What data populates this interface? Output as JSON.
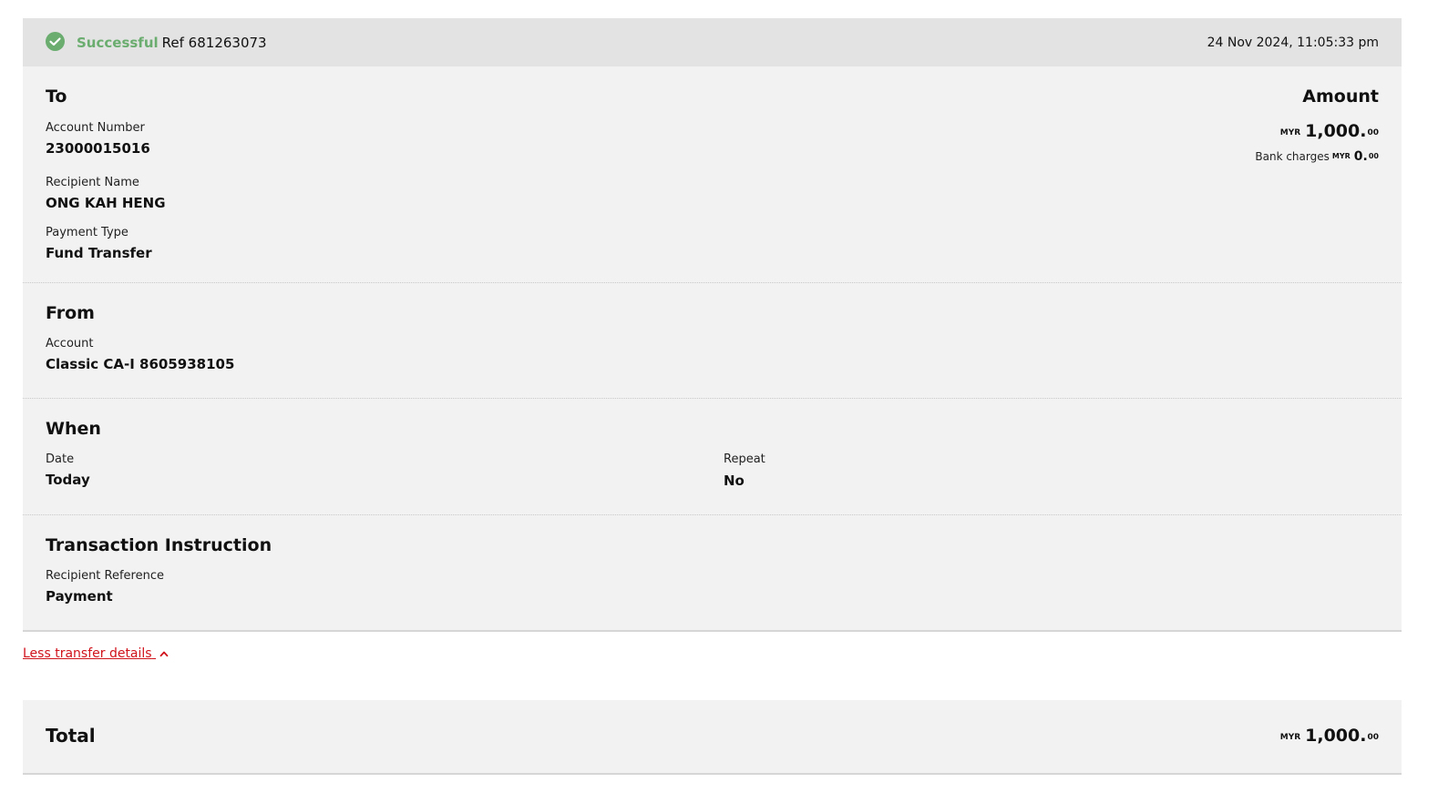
{
  "status": {
    "label": "Successful",
    "reference": "Ref 681263073",
    "timestamp": "24 Nov 2024, 11:05:33 pm"
  },
  "to": {
    "title": "To",
    "account_number_label": "Account Number",
    "account_number": "23000015016",
    "recipient_name_label": "Recipient Name",
    "recipient_name": "ONG KAH HENG",
    "payment_type_label": "Payment Type",
    "payment_type": "Fund Transfer"
  },
  "amount": {
    "title": "Amount",
    "currency": "MYR",
    "whole": "1,000.",
    "cents": "00",
    "bank_charges_label": "Bank charges",
    "bank_charges_currency": "MYR",
    "bank_charges_whole": "0.",
    "bank_charges_cents": "00"
  },
  "from": {
    "title": "From",
    "account_label": "Account",
    "account": "Classic CA-I 8605938105"
  },
  "when": {
    "title": "When",
    "date_label": "Date",
    "date": "Today",
    "repeat_label": "Repeat",
    "repeat": "No"
  },
  "instruction": {
    "title": "Transaction Instruction",
    "reference_label": "Recipient Reference",
    "reference": "Payment"
  },
  "toggle_link": "Less transfer details",
  "total": {
    "label": "Total",
    "currency": "MYR",
    "whole": "1,000.",
    "cents": "00"
  },
  "colors": {
    "success": "#6aad6f",
    "link": "#d0121b",
    "card_bg": "#f2f2f2",
    "status_bg": "#e3e3e3"
  },
  "icons": [
    "check-circle-icon",
    "chevron-up-icon"
  ]
}
